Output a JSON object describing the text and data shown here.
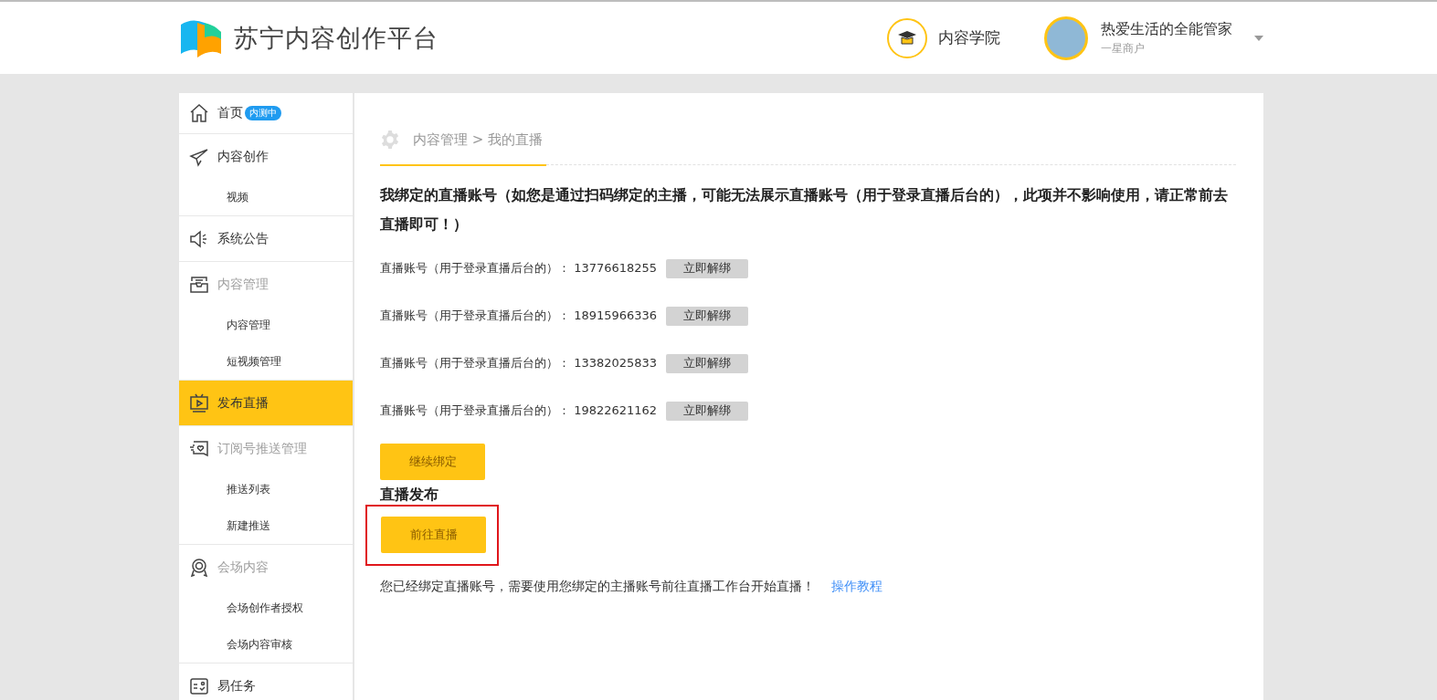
{
  "header": {
    "brand": "苏宁内容创作平台",
    "academy": "内容学院",
    "user": {
      "name": "热爱生活的全能管家",
      "level": "一星商户"
    }
  },
  "sidebar": {
    "groups": [
      {
        "label": "首页",
        "badge": "内测中",
        "muted": false,
        "selected": false
      },
      {
        "label": "内容创作",
        "muted": false,
        "selected": false,
        "children": [
          {
            "label": "视频",
            "selected": false
          }
        ]
      },
      {
        "label": "系统公告",
        "muted": false,
        "selected": false
      },
      {
        "label": "内容管理",
        "muted": true,
        "selected": false,
        "children": [
          {
            "label": "内容管理",
            "selected": false
          },
          {
            "label": "短视频管理",
            "selected": false
          }
        ]
      },
      {
        "label": "发布直播",
        "muted": false,
        "selected": true
      },
      {
        "label": "订阅号推送管理",
        "muted": true,
        "selected": false,
        "children": [
          {
            "label": "推送列表",
            "selected": false
          },
          {
            "label": "新建推送",
            "selected": false
          }
        ]
      },
      {
        "label": "会场内容",
        "muted": true,
        "selected": false,
        "children": [
          {
            "label": "会场创作者授权",
            "selected": false
          },
          {
            "label": "会场内容审核",
            "selected": false
          }
        ]
      },
      {
        "label": "易任务",
        "muted": false,
        "selected": false
      }
    ]
  },
  "breadcrumb": {
    "path": "内容管理",
    "separator": ">",
    "current": "我的直播"
  },
  "notice": "我绑定的直播账号（如您是通过扫码绑定的主播，可能无法展示直播账号（用于登录直播后台的），此项并不影响使用，请正常前去直播即可！）",
  "accounts": [
    {
      "label": "直播账号（用于登录直播后台的）：",
      "number": "13776618255",
      "action": "立即解绑"
    },
    {
      "label": "直播账号（用于登录直播后台的）：",
      "number": "18915966336",
      "action": "立即解绑"
    },
    {
      "label": "直播账号（用于登录直播后台的）：",
      "number": "13382025833",
      "action": "立即解绑"
    },
    {
      "label": "直播账号（用于登录直播后台的）：",
      "number": "19822621162",
      "action": "立即解绑"
    }
  ],
  "bind_more": "继续绑定",
  "publish": {
    "title": "直播发布",
    "button": "前往直播",
    "highlighted": true,
    "hint": "您已经绑定直播账号，需要使用您绑定的主播账号前往直播工作台开始直播！",
    "link": "操作教程"
  }
}
